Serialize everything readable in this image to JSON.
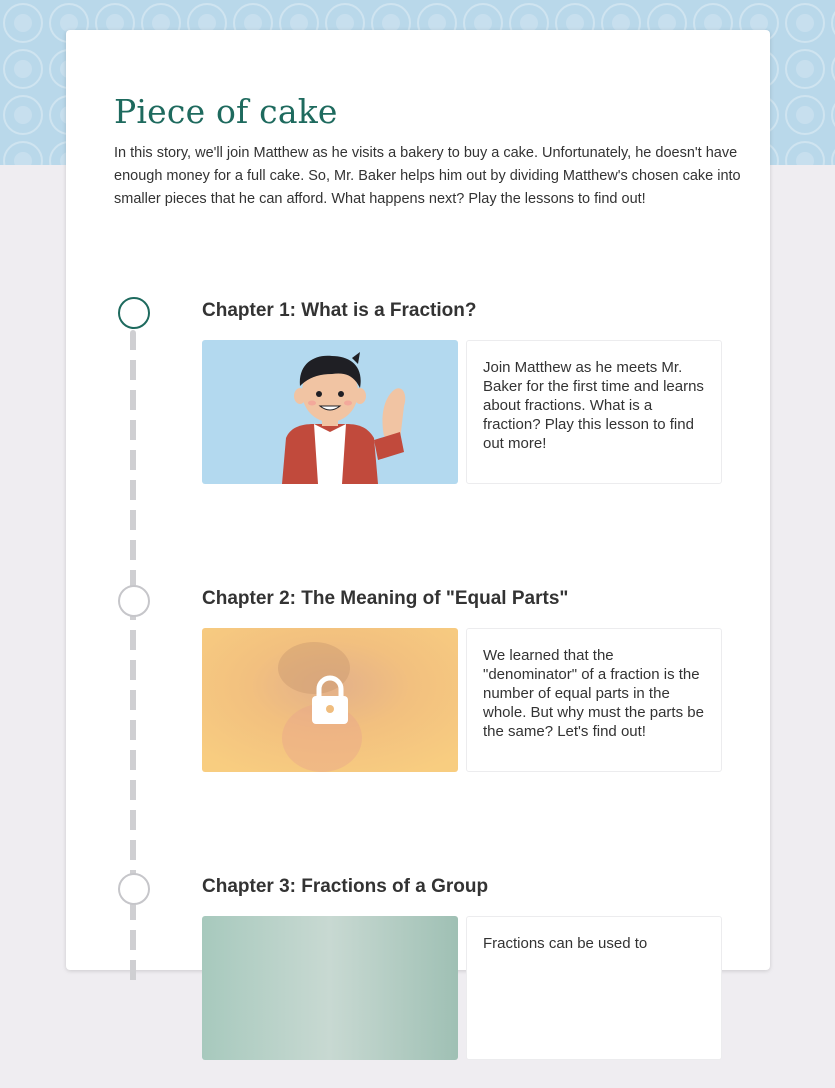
{
  "story": {
    "title": "Piece of cake",
    "description": "In this story, we'll join Matthew as he visits a bakery to buy a cake. Unfortunately, he doesn't have enough money for a full cake. So, Mr. Baker helps him out by dividing Matthew's chosen cake into smaller pieces that he can afford. What happens next? Play the lessons to find out!"
  },
  "chapters": [
    {
      "title": "Chapter 1: What is a Fraction?",
      "description": "Join Matthew as he meets Mr. Baker for the first time and learns about fractions. What is a fraction? Play this lesson to find out more!",
      "status": "unlocked",
      "thumbnail_icon": "matthew-waving-illustration"
    },
    {
      "title": "Chapter 2: The Meaning of \"Equal Parts\"",
      "description": "We learned that the \"denominator\" of a fraction is the number of equal parts in the whole. But why must the parts be the same? Let's find out!",
      "status": "locked",
      "thumbnail_icon": "lock-icon"
    },
    {
      "title": "Chapter 3: Fractions of a Group",
      "description": "Fractions can be used to",
      "status": "locked",
      "thumbnail_icon": "lock-icon"
    }
  ],
  "colors": {
    "accent": "#1e6a5e",
    "banner": "#b9d8ea",
    "page_background": "#efedf1",
    "thumb_chapter1": "#b3d9ef",
    "thumb_chapter2": "#f4c27d",
    "thumb_chapter3": "#9fc7b8"
  }
}
